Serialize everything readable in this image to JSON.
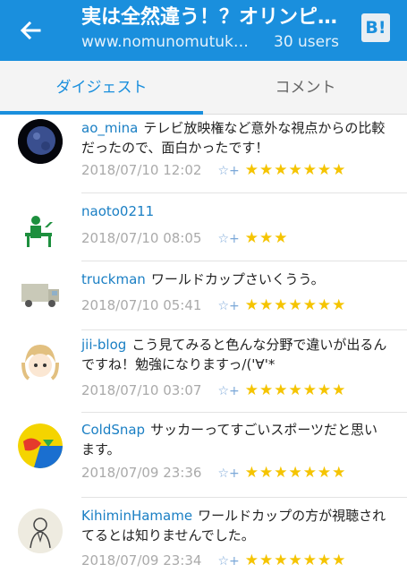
{
  "header": {
    "title": "実は全然違う！？オリンピ…",
    "domain": "www.nomunomutuk…",
    "users": "30 users",
    "bookmark_label": "B!"
  },
  "tabs": [
    {
      "label": "ダイジェスト",
      "active": true
    },
    {
      "label": "コメント",
      "active": false
    }
  ],
  "colors": {
    "accent": "#1a8fdd",
    "star": "#f5c400",
    "username": "#1a7fc4"
  },
  "comments": [
    {
      "user": "ao_mina",
      "text": "テレビ放映権など意外な視点からの比較だったので、面白かったです！",
      "time": "2018/07/10 12:02",
      "stars": "★★★★★★★"
    },
    {
      "user": "naoto0211",
      "text": "",
      "time": "2018/07/10 08:05",
      "stars": "★★★"
    },
    {
      "user": "truckman",
      "text": "ワールドカップさいくうう。",
      "time": "2018/07/10 05:41",
      "stars": "★★★★★★★"
    },
    {
      "user": "jii-blog",
      "text": "こう見てみると色んな分野で違いが出るんですね！勉強になりますっ/('∀'*",
      "time": "2018/07/10 03:07",
      "stars": "★★★★★★★"
    },
    {
      "user": "ColdSnap",
      "text": "サッカーってすごいスポーツだと思います。",
      "time": "2018/07/09 23:36",
      "stars": "★★★★★★★"
    },
    {
      "user": "KihiminHamame",
      "text": "ワールドカップの方が視聴されてるとは知りませんでした。",
      "time": "2018/07/09 23:34",
      "stars": "★★★★★★★"
    }
  ]
}
